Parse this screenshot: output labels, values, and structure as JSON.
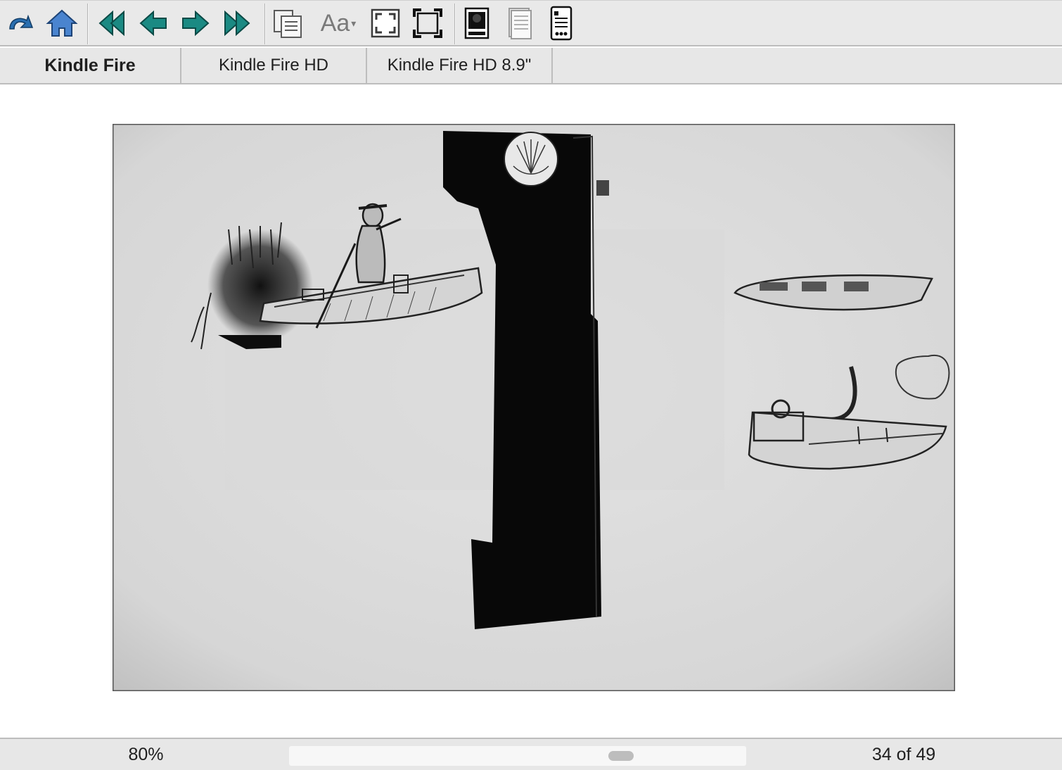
{
  "toolbar": {
    "buttons": [
      {
        "name": "back-icon",
        "color": "#2a6fb0"
      },
      {
        "name": "home-icon",
        "color": "#3e78c4"
      },
      {
        "name": "first-page-icon",
        "color": "#1b8a83"
      },
      {
        "name": "previous-page-icon",
        "color": "#1b8a83"
      },
      {
        "name": "next-page-icon",
        "color": "#1b8a83"
      },
      {
        "name": "last-page-icon",
        "color": "#1b8a83"
      },
      {
        "name": "copy-pages-icon",
        "color": "#5b5b5b"
      },
      {
        "name": "font-size-icon",
        "color": "#7a7a7a"
      },
      {
        "name": "fit-page-icon",
        "color": "#3a3a3a"
      },
      {
        "name": "actual-size-icon",
        "color": "#111111"
      },
      {
        "name": "image-view-icon",
        "color": "#111111"
      },
      {
        "name": "text-view-icon",
        "color": "#9a9a9a"
      },
      {
        "name": "device-view-icon",
        "color": "#111111"
      }
    ],
    "font_label": "Aa"
  },
  "tabs": [
    {
      "label": "Kindle Fire",
      "active": true
    },
    {
      "label": "Kindle Fire HD",
      "active": false
    },
    {
      "label": "Kindle Fire HD 8.9\"",
      "active": false
    }
  ],
  "status": {
    "zoom": "80%",
    "page": "34 of 49",
    "scroll_position": 0.74
  }
}
